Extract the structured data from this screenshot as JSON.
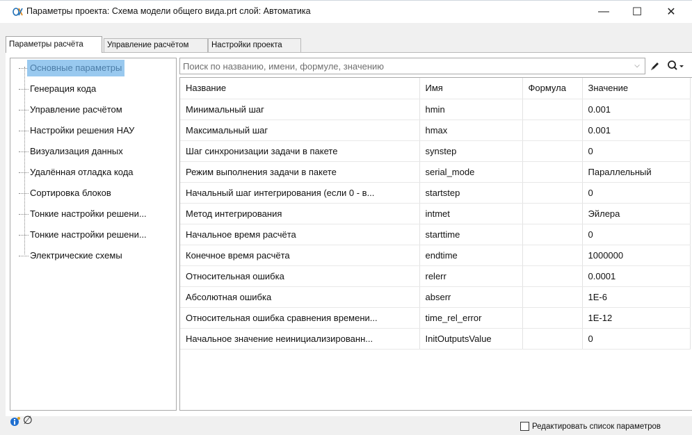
{
  "window": {
    "title": "Параметры проекта: Схема модели общего вида.prt  слой: Автоматика",
    "minimize_glyph": "—",
    "maximize_glyph": "☐",
    "close_glyph": "✕"
  },
  "tabs": [
    {
      "label": "Параметры расчёта",
      "active": true
    },
    {
      "label": "Управление расчётом",
      "active": false
    },
    {
      "label": "Настройки проекта",
      "active": false
    }
  ],
  "sidebar": {
    "items": [
      {
        "label": "Основные параметры",
        "selected": true
      },
      {
        "label": "Генерация кода"
      },
      {
        "label": "Управление расчётом"
      },
      {
        "label": "Настройки решения НАУ"
      },
      {
        "label": "Визуализация данных"
      },
      {
        "label": "Удалённая отладка кода"
      },
      {
        "label": "Сортировка блоков"
      },
      {
        "label": "Тонкие настройки решени..."
      },
      {
        "label": "Тонкие настройки решени..."
      },
      {
        "label": "Электрические схемы"
      }
    ]
  },
  "search": {
    "placeholder": "Поиск по названию, имени, формуле, значению",
    "dropdown_glyph": "⌵"
  },
  "table": {
    "headers": [
      "Название",
      "Имя",
      "Формула",
      "Значение"
    ],
    "rows": [
      [
        "Минимальный шаг",
        "hmin",
        "",
        "0.001"
      ],
      [
        "Максимальный шаг",
        "hmax",
        "",
        "0.001"
      ],
      [
        "Шаг синхронизации задачи в пакете",
        "synstep",
        "",
        "0"
      ],
      [
        "Режим выполнения задачи в пакете",
        "serial_mode",
        "",
        "Параллельный"
      ],
      [
        "Начальный шаг интегрирования (если 0 - в...",
        "startstep",
        "",
        "0"
      ],
      [
        "Метод интегрирования",
        "intmet",
        "",
        "Эйлера"
      ],
      [
        "Начальное время расчёта",
        "starttime",
        "",
        "0"
      ],
      [
        "Конечное время расчёта",
        "endtime",
        "",
        "1000000"
      ],
      [
        "Относительная ошибка",
        "relerr",
        "",
        "0.0001"
      ],
      [
        "Абсолютная ошибка",
        "abserr",
        "",
        "1E-6"
      ],
      [
        "Относительная ошибка сравнения времени...",
        "time_rel_error",
        "",
        "1E-12"
      ],
      [
        "Начальное значение неинициализированн...",
        "InitOutputsValue",
        "",
        "0"
      ]
    ]
  },
  "footer": {
    "null_glyph": "∅",
    "edit_checkbox_label": "Редактировать список параметров",
    "edit_checkbox_checked": false
  }
}
